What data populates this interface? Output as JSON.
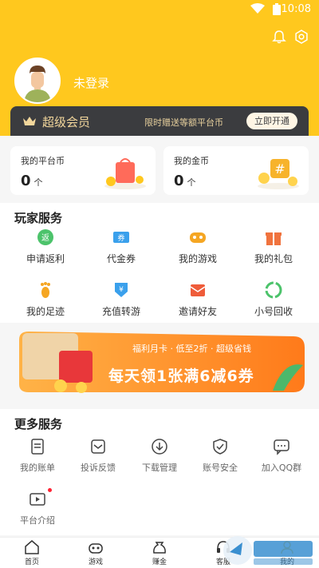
{
  "status_bar": {
    "time": "10:08"
  },
  "profile": {
    "login_text": "未登录"
  },
  "vip": {
    "title": "超级会员",
    "desc": "限时赠送等额平台币",
    "button": "立即开通"
  },
  "cards": [
    {
      "title": "我的平台币",
      "value": "0",
      "unit": "个"
    },
    {
      "title": "我的金币",
      "value": "0",
      "unit": "个"
    }
  ],
  "player_services": {
    "title": "玩家服务",
    "items": [
      {
        "label": "申请返利",
        "icon": "rebate-icon",
        "color": "#4cc36b"
      },
      {
        "label": "代金券",
        "icon": "voucher-icon",
        "color": "#3aa0ec"
      },
      {
        "label": "我的游戏",
        "icon": "gamepad-icon",
        "color": "#f5a623"
      },
      {
        "label": "我的礼包",
        "icon": "gift-icon",
        "color": "#f0733e"
      },
      {
        "label": "我的足迹",
        "icon": "footprint-icon",
        "color": "#f5a623"
      },
      {
        "label": "充值转游",
        "icon": "transfer-icon",
        "color": "#3aa0ec"
      },
      {
        "label": "邀请好友",
        "icon": "invite-icon",
        "color": "#ef5c3a"
      },
      {
        "label": "小号回收",
        "icon": "recycle-icon",
        "color": "#4cc36b"
      }
    ]
  },
  "banner": {
    "top_text": "福利月卡 · 低至2折 · 超级省钱",
    "main_text": "每天领1张满6减6券"
  },
  "more_services": {
    "title": "更多服务",
    "items": [
      {
        "label": "我的账单",
        "icon": "bill-icon"
      },
      {
        "label": "投诉反馈",
        "icon": "feedback-icon"
      },
      {
        "label": "下载管理",
        "icon": "download-icon"
      },
      {
        "label": "账号安全",
        "icon": "shield-icon"
      },
      {
        "label": "加入QQ群",
        "icon": "chat-icon"
      },
      {
        "label": "平台介绍",
        "icon": "film-icon"
      }
    ]
  },
  "tabbar": {
    "items": [
      {
        "label": "首页",
        "icon": "home-icon"
      },
      {
        "label": "游戏",
        "icon": "game-icon"
      },
      {
        "label": "赚金",
        "icon": "money-bag-icon"
      },
      {
        "label": "客服",
        "icon": "service-icon"
      },
      {
        "label": "我的",
        "icon": "user-icon"
      }
    ]
  },
  "colors": {
    "brand": "#ffc81e",
    "vip_bg": "#3b3c3f",
    "vip_text": "#f3d79c"
  }
}
